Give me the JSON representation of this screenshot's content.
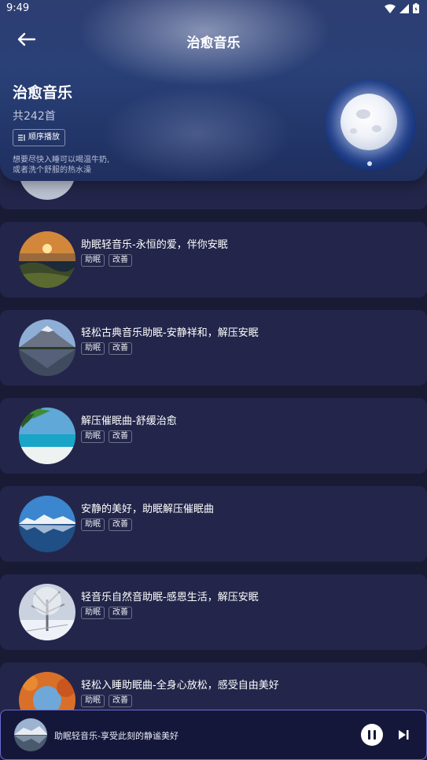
{
  "status_bar": {
    "time": "9:49"
  },
  "header": {
    "title": "治愈音乐",
    "playlist_name": "治愈音乐",
    "count": "共242首",
    "order_button": "顺序播放",
    "description_line1": "想要尽快入睡可以喝温牛奶,",
    "description_line2": "或者洗个舒服的热水澡"
  },
  "songs": [
    {
      "title": "助眠轻音乐-永恒的爱，伴你安眠",
      "tags": [
        "助眠",
        "改善"
      ],
      "image": "sunset-lake"
    },
    {
      "title": "轻松古典音乐助眠-安静祥和，解压安眠",
      "tags": [
        "助眠",
        "改善"
      ],
      "image": "mountain-lake"
    },
    {
      "title": "解压催眠曲-舒缓治愈",
      "tags": [
        "助眠",
        "改善"
      ],
      "image": "tropical-beach"
    },
    {
      "title": "安静的美好，助眠解压催眠曲",
      "tags": [
        "助眠",
        "改善"
      ],
      "image": "snow-mountain-reflection"
    },
    {
      "title": "轻音乐自然音助眠-感恩生活，解压安眠",
      "tags": [
        "助眠",
        "改善"
      ],
      "image": "snowy-tree"
    },
    {
      "title": "轻松入睡助眠曲-全身心放松，感受自由美好",
      "tags": [
        "助眠",
        "改善"
      ],
      "image": "autumn-forest"
    }
  ],
  "player": {
    "now_playing": "助眠轻音乐-享受此刻的静谧美好"
  },
  "colors": {
    "background": "#191b35",
    "card": "#23264a",
    "player_border": "#6a6fd0"
  }
}
